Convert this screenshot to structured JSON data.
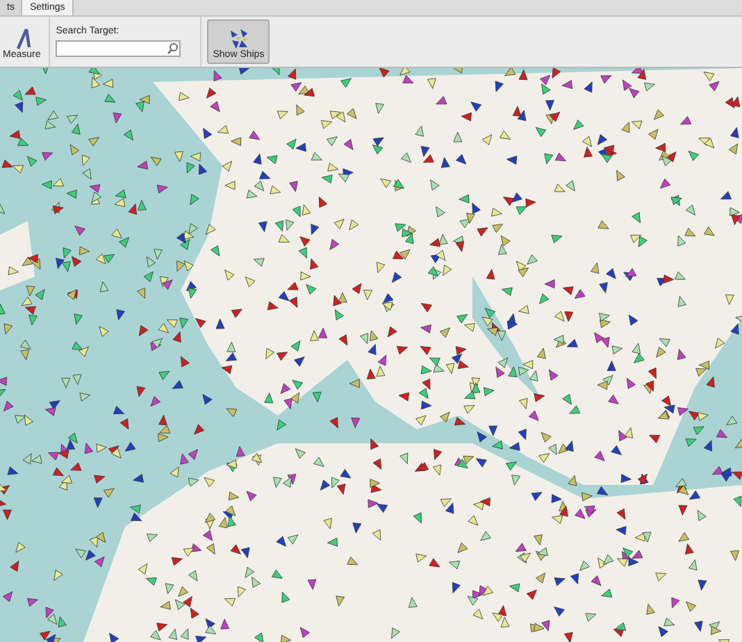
{
  "tabs": [
    {
      "label": "ts",
      "selected": false
    },
    {
      "label": "Settings",
      "selected": true
    }
  ],
  "toolbar": {
    "measure_button": {
      "label": "Measure"
    },
    "search": {
      "label": "Search Target:"
    },
    "show_ships_button": {
      "label": "Show Ships",
      "pressed": true
    }
  }
}
